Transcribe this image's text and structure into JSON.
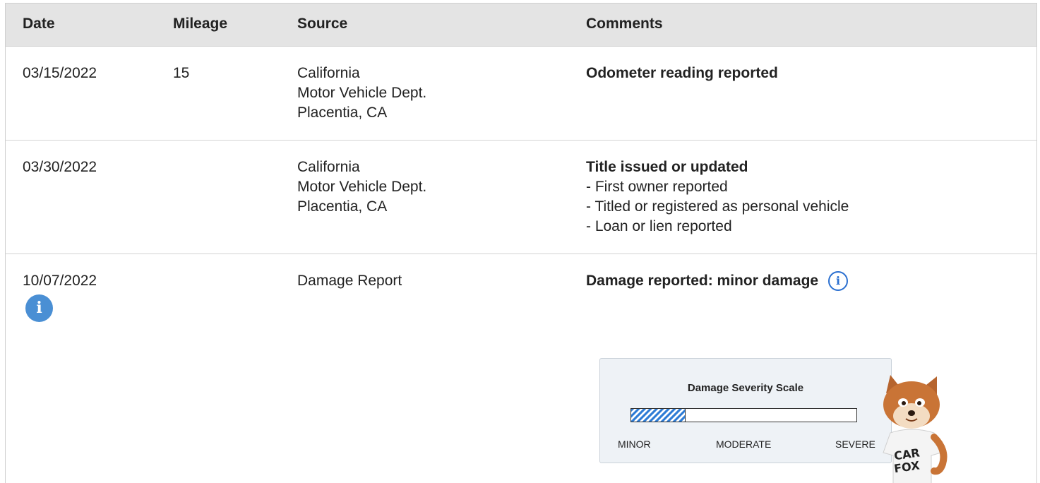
{
  "headers": {
    "date": "Date",
    "mileage": "Mileage",
    "source": "Source",
    "comments": "Comments"
  },
  "rows": [
    {
      "date": "03/15/2022",
      "mileage": "15",
      "source": [
        "California",
        "Motor Vehicle Dept.",
        "Placentia, CA"
      ],
      "comment_title": "Odometer reading reported",
      "comment_lines": []
    },
    {
      "date": "03/30/2022",
      "mileage": "",
      "source": [
        "California",
        "Motor Vehicle Dept.",
        "Placentia, CA"
      ],
      "comment_title": "Title issued or updated",
      "comment_lines": [
        "- First owner reported",
        "- Titled or registered as personal vehicle",
        "- Loan or lien reported"
      ]
    },
    {
      "date": "10/07/2022",
      "mileage": "",
      "source": [
        "Damage Report"
      ],
      "comment_title": "Damage reported: minor damage",
      "comment_lines": []
    }
  ],
  "icons": {
    "row_info": "info-icon",
    "comment_info": "info-icon"
  },
  "damage_scale": {
    "title": "Damage Severity Scale",
    "labels": [
      "MINOR",
      "MODERATE",
      "SEVERE"
    ],
    "level_fraction": 0.24,
    "accent": "#2f7dd6"
  },
  "mascot": {
    "shirt_text": [
      "CAR",
      "FOX"
    ]
  }
}
